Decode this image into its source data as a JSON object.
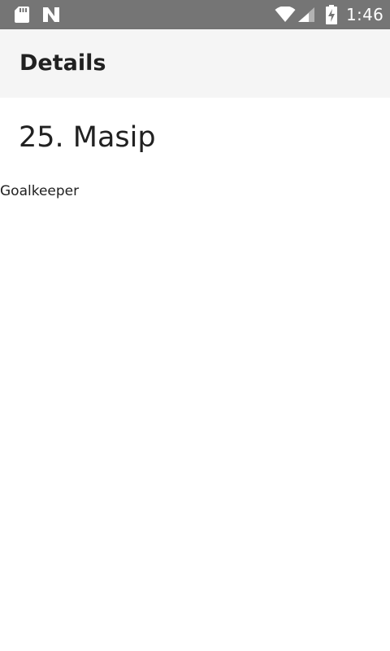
{
  "status_bar": {
    "time": "1:46",
    "icons": [
      "sd-card-icon",
      "n-icon",
      "wifi-icon",
      "signal-icon",
      "battery-charging-icon"
    ]
  },
  "app_bar": {
    "title": "Details"
  },
  "player": {
    "name": "25. Masip",
    "position": "Goalkeeper"
  }
}
